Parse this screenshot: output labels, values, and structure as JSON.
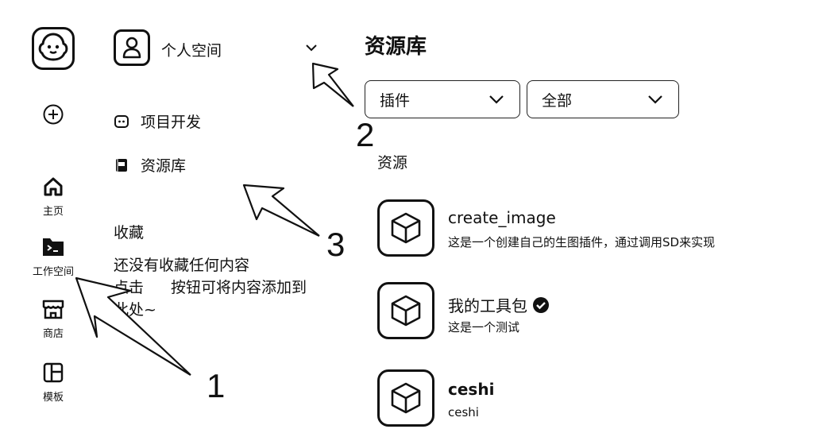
{
  "sidebar": {
    "items": [
      {
        "label": "主页",
        "icon": "home-icon"
      },
      {
        "label": "工作空间",
        "icon": "workspace-icon"
      },
      {
        "label": "商店",
        "icon": "store-icon"
      },
      {
        "label": "模板",
        "icon": "template-icon"
      }
    ],
    "plus_icon": "plus-circle-icon"
  },
  "space": {
    "name": "个人空间",
    "menu": [
      {
        "label": "项目开发",
        "icon": "robot-icon"
      },
      {
        "label": "资源库",
        "icon": "library-icon"
      }
    ],
    "favorites_title": "收藏",
    "favorites_empty_line1": "还没有收藏任何内容",
    "favorites_empty_line2": "点击",
    "favorites_empty_line2b": "按钮可将内容添加到",
    "favorites_empty_line3": "此处~"
  },
  "main": {
    "title": "资源库",
    "filters": {
      "type": "插件",
      "scope": "全部"
    },
    "section_label": "资源",
    "resources": [
      {
        "name": "create_image",
        "description": "这是一个创建自己的生图插件，通过调用SD来实现",
        "verified": false
      },
      {
        "name": "我的工具包",
        "description": "这是一个测试",
        "verified": true
      },
      {
        "name": "ceshi",
        "description": "ceshi",
        "verified": false
      }
    ]
  },
  "annotations": {
    "one": "1",
    "two": "2",
    "three": "3"
  }
}
